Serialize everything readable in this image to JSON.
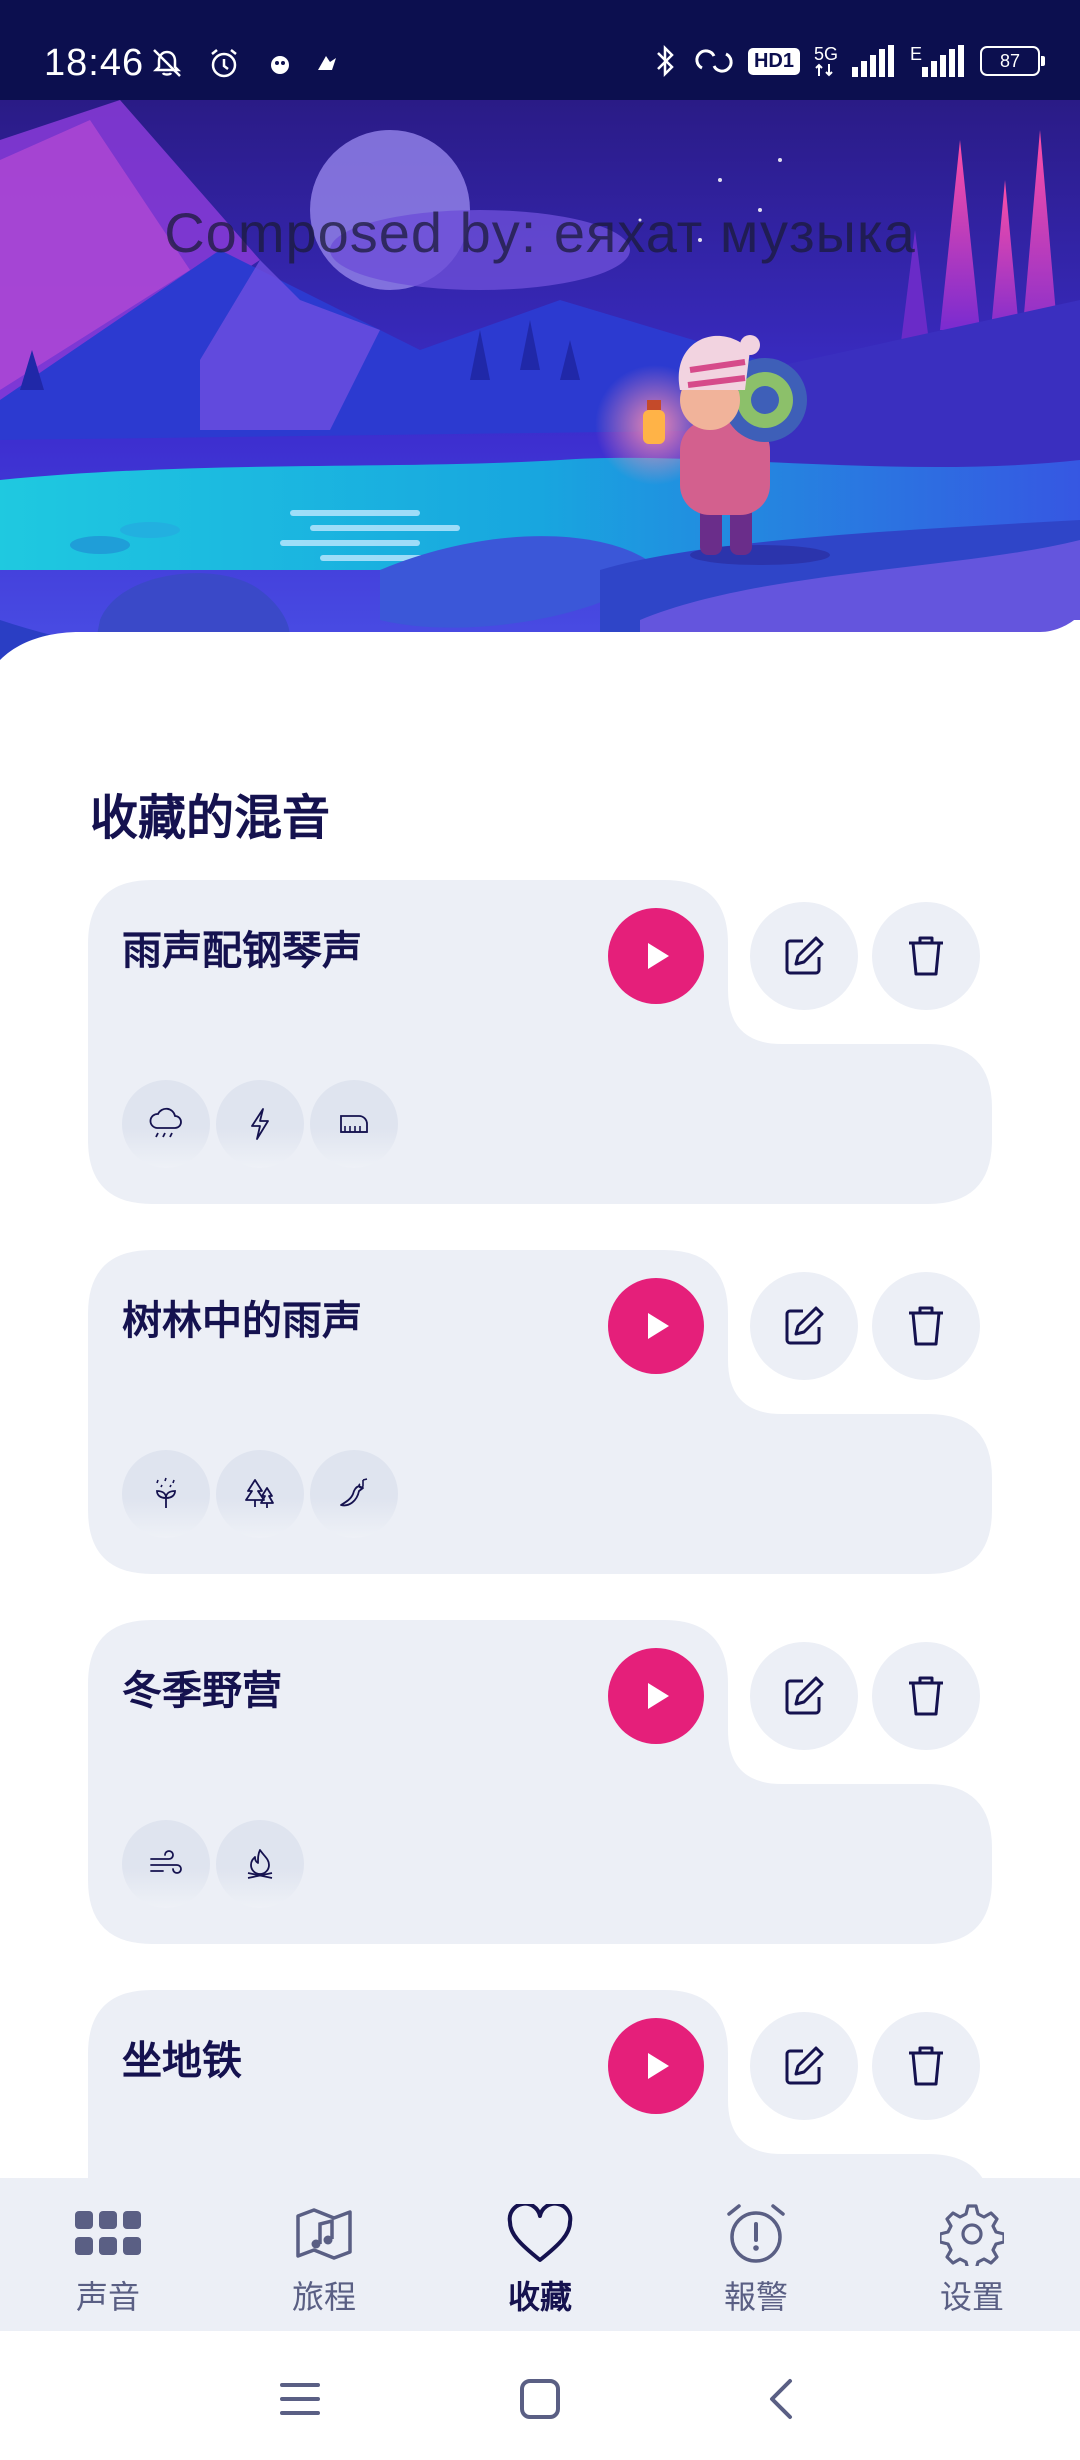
{
  "status_bar": {
    "time": "18:46",
    "hd_badge": "HD1",
    "network_top": "5G",
    "network_mid": "E",
    "battery": "87"
  },
  "hero": {
    "caption": "Composed by: еяхат музыка"
  },
  "favorites": {
    "title": "收藏的混音",
    "mixes": [
      {
        "title": "雨声配钢琴声",
        "sounds": [
          "rain-cloud-icon",
          "lightning-icon",
          "piano-icon"
        ]
      },
      {
        "title": "树林中的雨声",
        "sounds": [
          "sprout-rain-icon",
          "forest-icon",
          "bird-song-icon"
        ]
      },
      {
        "title": "冬季野营",
        "sounds": [
          "wind-icon",
          "campfire-icon"
        ]
      },
      {
        "title": "坐地铁",
        "sounds": []
      }
    ]
  },
  "bottom_nav": {
    "active": "收藏",
    "items": [
      {
        "label": "声音",
        "icon": "grid-icon"
      },
      {
        "label": "旅程",
        "icon": "map-music-icon"
      },
      {
        "label": "收藏",
        "icon": "heart-icon"
      },
      {
        "label": "報警",
        "icon": "alarm-icon"
      },
      {
        "label": "设置",
        "icon": "gear-icon"
      }
    ]
  },
  "colors": {
    "accent": "#e51f7a",
    "navy": "#15124f",
    "card": "#eceff6",
    "status_bar": "#0c0f4f"
  }
}
